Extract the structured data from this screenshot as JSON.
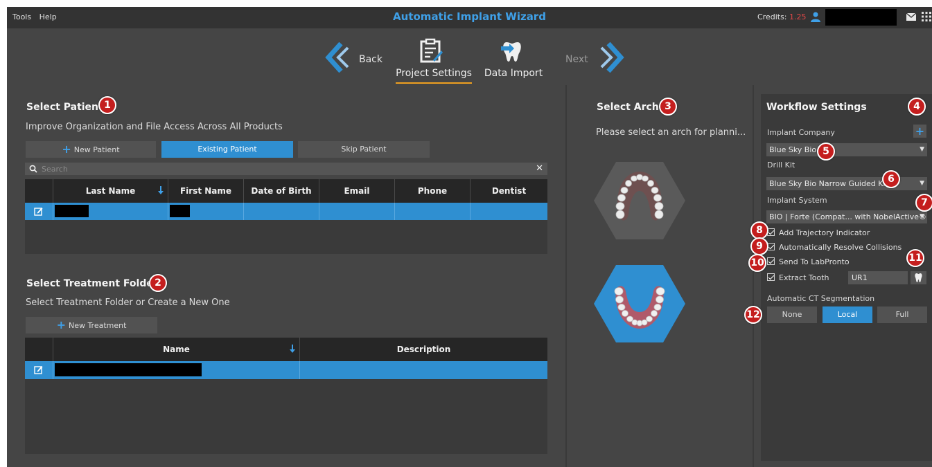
{
  "menu": [
    "Tools",
    "Help"
  ],
  "app_title": "Automatic Implant Wizard",
  "credits": {
    "label": "Credits:",
    "value": "1.25"
  },
  "nav": {
    "back": "Back",
    "steps": [
      {
        "label": "Project Settings",
        "icon": "clipboard-icon",
        "active": true
      },
      {
        "label": "Data Import",
        "icon": "tooth-import-icon",
        "active": false
      }
    ],
    "next": "Next"
  },
  "patient": {
    "title": "Select Patient",
    "subtitle": "Improve Organization and File Access Across All Products",
    "buttons": {
      "new": "New Patient",
      "existing": "Existing Patient",
      "skip": "Skip Patient"
    },
    "search_placeholder": "Search",
    "columns": [
      "Last Name",
      "First Name",
      "Date of Birth",
      "Email",
      "Phone",
      "Dentist"
    ]
  },
  "treatment": {
    "title": "Select Treatment Folder",
    "subtitle": "Select Treatment Folder or Create a New One",
    "new_button": "New Treatment",
    "columns": [
      "Name",
      "Description"
    ]
  },
  "arch": {
    "title": "Select Arch",
    "subtitle": "Please select an arch for planni..."
  },
  "workflow": {
    "title": "Workflow Settings",
    "implant_company_label": "Implant Company",
    "implant_company": "Blue Sky Bio",
    "drill_kit_label": "Drill Kit",
    "drill_kit": "Blue Sky Bio Narrow Guided Kit",
    "implant_system_label": "Implant System",
    "implant_system": "BIO | Forte (Compat... with NobelActive®)",
    "checkboxes": [
      "Add Trajectory Indicator",
      "Automatically Resolve Collisions",
      "Send To LabPronto",
      "Extract Tooth"
    ],
    "tooth_value": "UR1",
    "segmentation_label": "Automatic CT Segmentation",
    "segmentation_options": [
      "None",
      "Local",
      "Full"
    ],
    "segmentation_selected": "Local"
  },
  "badges": [
    "1",
    "2",
    "3",
    "4",
    "5",
    "6",
    "7",
    "8",
    "9",
    "10",
    "11",
    "12"
  ],
  "colors": {
    "accent": "#2f8fd1",
    "title": "#3fa0e8",
    "badge": "#c41e1e",
    "credits": "#e04848",
    "underline": "#f0a020"
  }
}
